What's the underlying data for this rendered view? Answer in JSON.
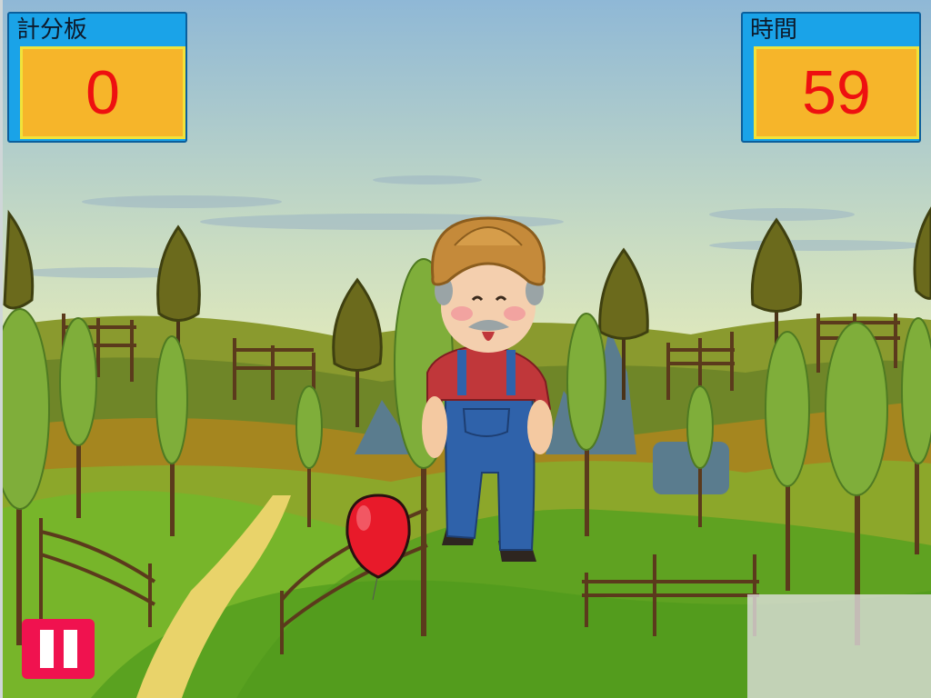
{
  "scoreboard": {
    "label": "計分板",
    "value": "0"
  },
  "timer": {
    "label": "時間",
    "value": "59"
  },
  "pause": {
    "icon": "pause-icon"
  },
  "balloon": {
    "color": "#e81a2a"
  },
  "colors": {
    "panel": "#1aa3e8",
    "value_bg": "#f6b52a",
    "value_text": "#ee1010",
    "pause_bg": "#f0124f"
  }
}
